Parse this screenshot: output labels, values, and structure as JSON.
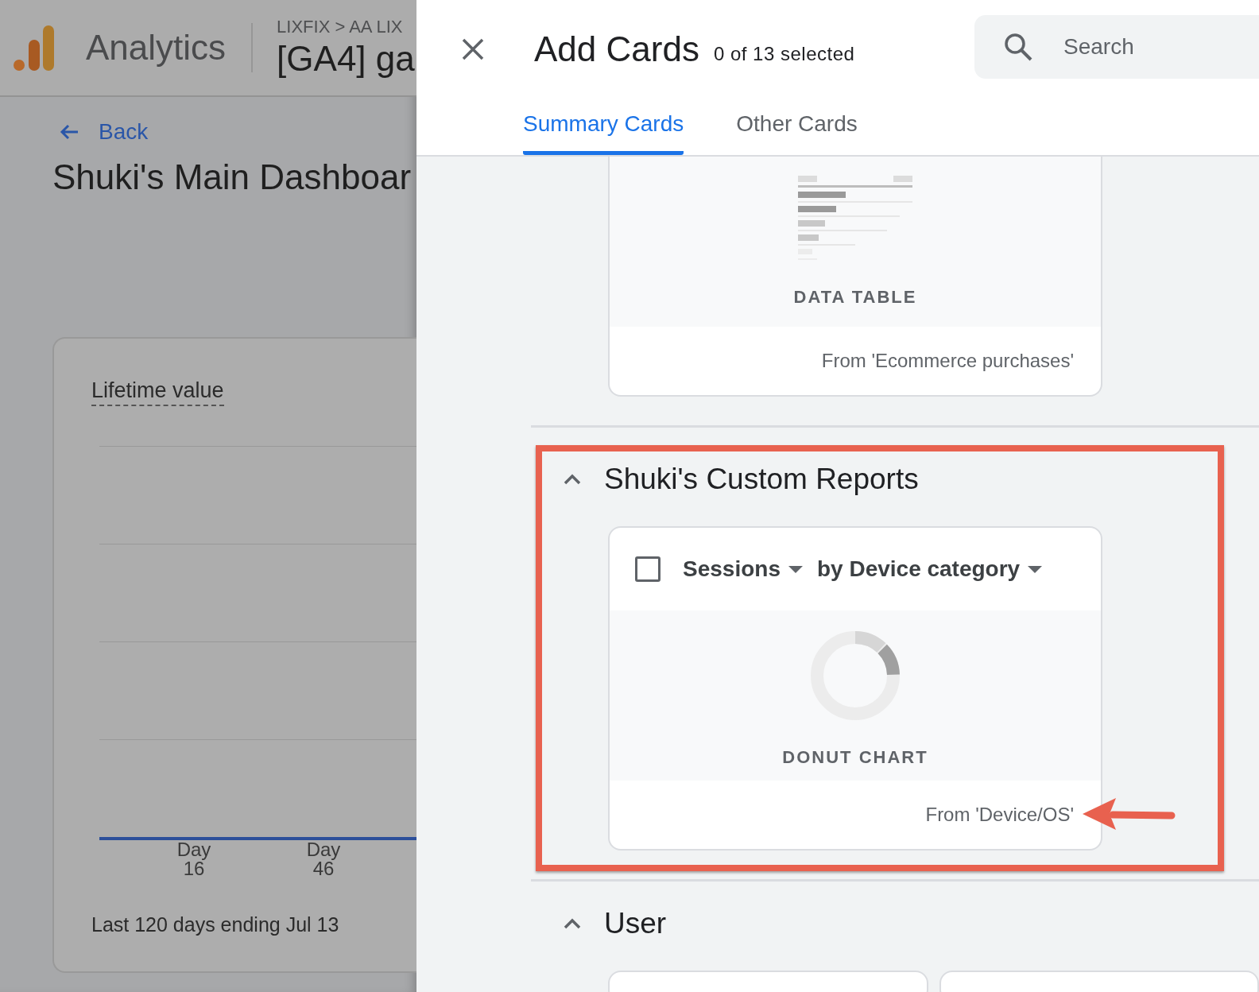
{
  "background_page": {
    "app_name": "Analytics",
    "breadcrumb": "LIXFIX > AA LIX",
    "property": "[GA4] ga",
    "back_link": "Back",
    "dashboard_title": "Shuki's Main Dashboar",
    "card": {
      "title": "Lifetime value",
      "x_labels": [
        "Day 16",
        "Day 46"
      ],
      "footer": "Last 120 days ending Jul 13"
    }
  },
  "panel": {
    "title": "Add Cards",
    "selection_count": "0 of 13 selected",
    "search": {
      "placeholder": "Search"
    },
    "tabs": [
      {
        "label": "Summary Cards",
        "selected": true
      },
      {
        "label": "Other Cards",
        "selected": false
      }
    ],
    "sections": [
      {
        "highlighted": false,
        "cards": [
          {
            "kind": "data_table",
            "chart_label": "DATA TABLE",
            "source": "From 'Ecommerce purchases'",
            "arrow": false
          }
        ]
      },
      {
        "title": "Shuki's Custom Reports",
        "expanded": true,
        "highlighted": true,
        "cards": [
          {
            "kind": "donut",
            "checked": false,
            "metric": "Sessions",
            "dimension": "by Device category",
            "chart_label": "DONUT CHART",
            "source": "From 'Device/OS'",
            "arrow": true
          }
        ]
      },
      {
        "title": "User",
        "expanded": true,
        "highlighted": false,
        "cards": [
          {
            "kind": "stub"
          },
          {
            "kind": "stub"
          }
        ]
      }
    ]
  }
}
